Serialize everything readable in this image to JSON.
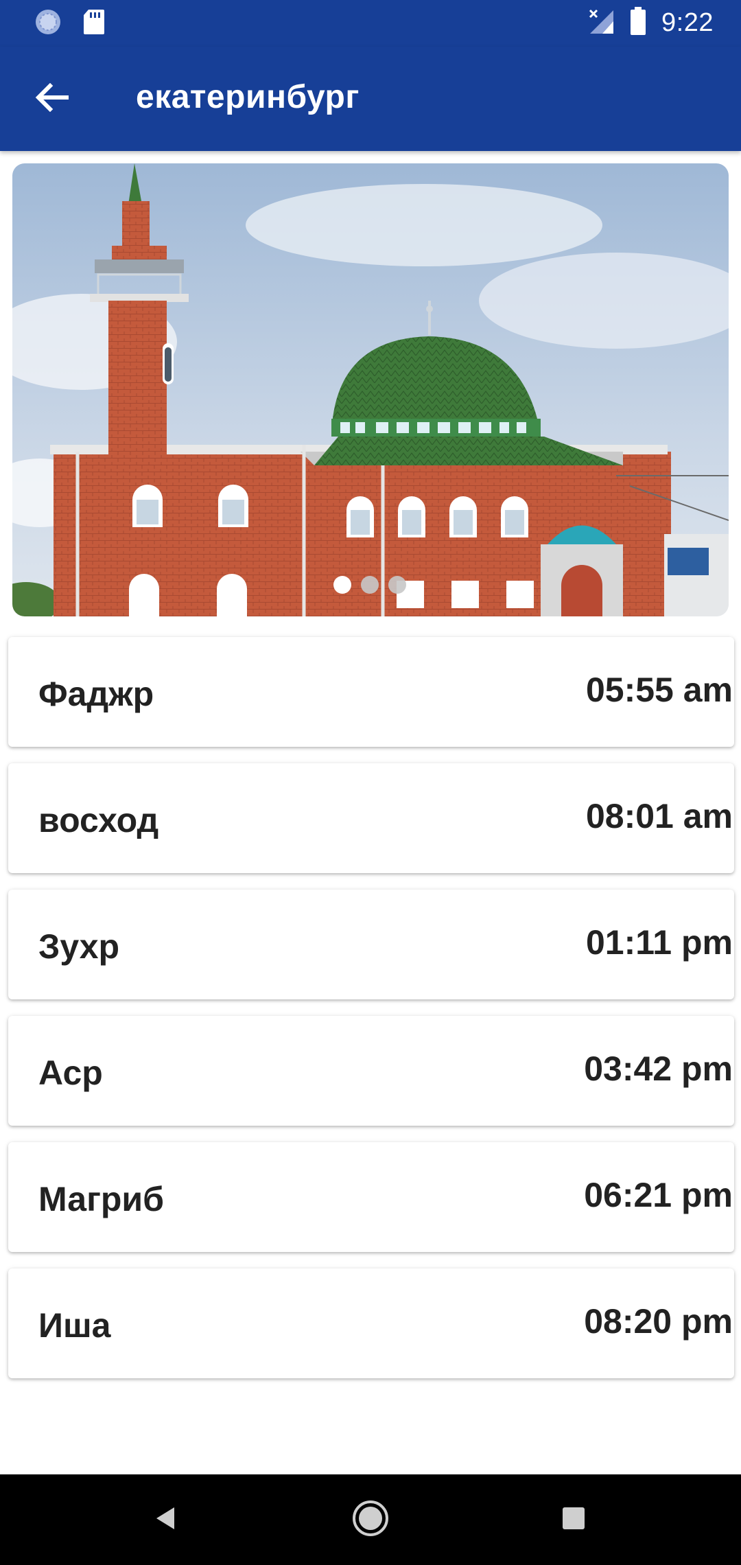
{
  "status_bar": {
    "time": "9:22",
    "icons": [
      "sync-icon",
      "sd-card-icon",
      "signal-off-icon",
      "battery-icon"
    ]
  },
  "app_bar": {
    "title": "екатеринбург",
    "back_icon": "arrow-left-icon"
  },
  "carousel": {
    "image": "mosque-photo",
    "page_count": 3,
    "active_page": 1
  },
  "prayers": [
    {
      "name": "Фаджр",
      "time": "05:55 am"
    },
    {
      "name": "восход",
      "time": "08:01 am"
    },
    {
      "name": "Зухр",
      "time": "01:11 pm"
    },
    {
      "name": "Аср",
      "time": "03:42 pm"
    },
    {
      "name": "Магриб",
      "time": "06:21 pm"
    },
    {
      "name": "Иша",
      "time": "08:20 pm"
    }
  ],
  "nav_bar": {
    "buttons": [
      "back-triangle-icon",
      "home-circle-icon",
      "recents-square-icon"
    ]
  },
  "colors": {
    "primary": "#173f97",
    "text": "#222222",
    "nav": "#000000"
  }
}
